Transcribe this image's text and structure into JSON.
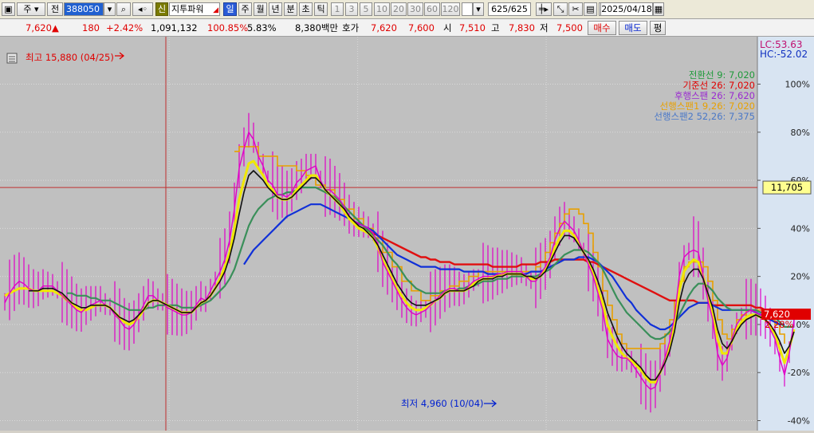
{
  "toolbar": {
    "period_label": "주",
    "market_label": "전",
    "stock_code": "388050",
    "new_badge": "신",
    "stock_name": "지투파워",
    "tab_day": "일",
    "tab_week": "주",
    "tab_month": "월",
    "tab_year": "년",
    "tab_minute": "분",
    "tab_second": "초",
    "tab_tick": "틱",
    "intervals": [
      "1",
      "3",
      "5",
      "10",
      "20",
      "30",
      "60",
      "120"
    ],
    "count": "625",
    "total": "/625",
    "date": "2025/04/18"
  },
  "quote": {
    "price": "7,620",
    "change": "180",
    "change_pct": "+2.42%",
    "volume": "1,091,132",
    "volume_ratio": "100.85%",
    "turnover": "5.83%",
    "amount": "8,380백만",
    "bid_ask_label": "호가",
    "ask": "7,620",
    "bid": "7,600",
    "open_label": "시",
    "open": "7,510",
    "high_label": "고",
    "high": "7,830",
    "low_label": "저",
    "low": "7,500",
    "buy_label": "매수",
    "sell_label": "매도",
    "avg_label": "평"
  },
  "colors": {
    "plot_bg": "#c0c0c0",
    "axis_bg": "#d8e4f2",
    "conversion": "#1e9a3a",
    "base": "#e00000",
    "lagging": "#9a2ad0",
    "span1": "#e8a000",
    "span2": "#4a78c8",
    "candle": "#e000c8",
    "ma_yellow": "#f0e800",
    "ma_black": "#111111",
    "ma_green": "#3a8f5a",
    "ma_blue": "#1030d8",
    "ma_red": "#e01010"
  },
  "chart_data": {
    "type": "line",
    "ylabel": "",
    "ylim": [
      -40,
      110
    ],
    "y_ticks": [
      "100%",
      "80%",
      "60%",
      "40%",
      "20%",
      "0%",
      "-20%",
      "-40%"
    ],
    "y_tick_values": [
      100,
      80,
      60,
      40,
      20,
      0,
      -20,
      -40
    ],
    "grid": true,
    "lc_label": "LC:53.63",
    "hc_label": "HC:-52.02",
    "crosshair_price": "11,705",
    "crosshair_y": 57,
    "last_price_label": "7,620",
    "last_pct_label": "2.28%",
    "last_y": 2.3,
    "high_annotation": "최고 15,880 (04/25)",
    "low_annotation": "최저 4,960 (10/04)",
    "legend": [
      {
        "name": "전환선 9: 7,020",
        "color": "#1e9a3a"
      },
      {
        "name": "기준선 26: 7,020",
        "color": "#e00000"
      },
      {
        "name": "후행스팬 26: 7,620",
        "color": "#9a2ad0"
      },
      {
        "name": "선행스팬1 9,26: 7,020",
        "color": "#e8a000"
      },
      {
        "name": "선행스팬2 52,26: 7,375",
        "color": "#4a78c8"
      }
    ],
    "x_count": 157,
    "series": [
      {
        "key": "close",
        "values": [
          9,
          13,
          16,
          18,
          17,
          15,
          14,
          14,
          16,
          16,
          16,
          14,
          12,
          10,
          8,
          6,
          5,
          7,
          8,
          9,
          10,
          8,
          7,
          4,
          2,
          -1,
          -2,
          0,
          4,
          8,
          12,
          12,
          10,
          9,
          7,
          6,
          5,
          4,
          4,
          5,
          8,
          11,
          10,
          14,
          18,
          22,
          27,
          35,
          48,
          65,
          73,
          80,
          77,
          70,
          66,
          60,
          58,
          54,
          54,
          53,
          55,
          59,
          61,
          64,
          65,
          66,
          60,
          56,
          56,
          54,
          52,
          49,
          45,
          43,
          42,
          41,
          40,
          38,
          33,
          26,
          22,
          18,
          14,
          10,
          7,
          5,
          4,
          5,
          6,
          8,
          10,
          12,
          14,
          15,
          15,
          14,
          14,
          16,
          18,
          19,
          20,
          20,
          20,
          21,
          21,
          22,
          22,
          22,
          22,
          20,
          18,
          18,
          21,
          24,
          28,
          35,
          40,
          43,
          41,
          39,
          35,
          30,
          25,
          20,
          13,
          6,
          -6,
          -10,
          -13,
          -14,
          -14,
          -16,
          -19,
          -22,
          -25,
          -27,
          -26,
          -20,
          -14,
          -7,
          3,
          20,
          28,
          30,
          31,
          30,
          20,
          10,
          2,
          -12,
          -17,
          -14,
          -6,
          0,
          3,
          5,
          6,
          5,
          4,
          2,
          -2,
          -6,
          -14,
          -21,
          -12,
          2
        ]
      },
      {
        "key": "yellow",
        "values": [
          12,
          13,
          14,
          15,
          15,
          15,
          14,
          14,
          14,
          14,
          14,
          13,
          12,
          10,
          9,
          7,
          6,
          6,
          7,
          8,
          8,
          8,
          7,
          5,
          3,
          1,
          0,
          1,
          3,
          6,
          9,
          10,
          10,
          9,
          8,
          7,
          6,
          5,
          5,
          5,
          7,
          9,
          10,
          12,
          15,
          19,
          24,
          30,
          40,
          52,
          60,
          67,
          68,
          65,
          62,
          58,
          56,
          53,
          52,
          52,
          53,
          56,
          58,
          60,
          62,
          62,
          59,
          56,
          54,
          52,
          50,
          47,
          44,
          42,
          40,
          39,
          38,
          36,
          32,
          27,
          23,
          19,
          15,
          12,
          9,
          7,
          6,
          6,
          7,
          8,
          10,
          11,
          13,
          14,
          14,
          14,
          14,
          15,
          17,
          18,
          19,
          19,
          20,
          20,
          21,
          21,
          21,
          21,
          21,
          20,
          19,
          19,
          20,
          23,
          27,
          32,
          36,
          39,
          39,
          37,
          34,
          30,
          26,
          21,
          15,
          9,
          0,
          -5,
          -9,
          -12,
          -14,
          -15,
          -17,
          -19,
          -22,
          -24,
          -24,
          -20,
          -15,
          -9,
          0,
          14,
          22,
          25,
          27,
          26,
          20,
          12,
          5,
          -6,
          -12,
          -12,
          -7,
          -2,
          1,
          3,
          4,
          4,
          3,
          2,
          -1,
          -4,
          -10,
          -16,
          -10,
          -2
        ]
      },
      {
        "key": "black",
        "values": [
          null,
          null,
          null,
          null,
          null,
          14,
          14,
          14,
          15,
          15,
          15,
          14,
          13,
          11,
          9,
          8,
          7,
          7,
          8,
          8,
          8,
          8,
          7,
          5,
          3,
          2,
          1,
          2,
          4,
          6,
          9,
          10,
          10,
          9,
          8,
          7,
          6,
          5,
          5,
          5,
          7,
          9,
          10,
          12,
          15,
          18,
          22,
          28,
          36,
          46,
          55,
          62,
          64,
          62,
          60,
          57,
          55,
          53,
          52,
          52,
          53,
          55,
          57,
          59,
          61,
          61,
          59,
          56,
          54,
          52,
          50,
          48,
          45,
          43,
          41,
          40,
          38,
          36,
          33,
          29,
          25,
          21,
          17,
          14,
          11,
          9,
          8,
          8,
          8,
          9,
          10,
          11,
          13,
          14,
          14,
          14,
          14,
          15,
          16,
          18,
          19,
          19,
          19,
          20,
          20,
          21,
          21,
          21,
          21,
          20,
          20,
          19,
          20,
          22,
          26,
          30,
          34,
          37,
          37,
          36,
          33,
          30,
          27,
          23,
          18,
          12,
          5,
          0,
          -5,
          -9,
          -12,
          -14,
          -16,
          -18,
          -21,
          -23,
          -23,
          -20,
          -16,
          -11,
          -3,
          9,
          17,
          21,
          23,
          23,
          19,
          13,
          7,
          -2,
          -8,
          -10,
          -7,
          -3,
          0,
          2,
          3,
          4,
          3,
          2,
          0,
          -3,
          -7,
          -12,
          -9,
          -3
        ]
      },
      {
        "key": "green",
        "values": [
          null,
          null,
          null,
          null,
          null,
          null,
          null,
          null,
          null,
          null,
          null,
          null,
          null,
          13,
          13,
          12,
          12,
          12,
          11,
          11,
          10,
          10,
          10,
          9,
          8,
          7,
          6,
          6,
          6,
          6,
          7,
          7,
          8,
          8,
          8,
          8,
          8,
          7,
          7,
          7,
          7,
          8,
          9,
          10,
          12,
          14,
          16,
          19,
          23,
          29,
          35,
          41,
          45,
          48,
          50,
          52,
          53,
          54,
          54,
          55,
          55,
          56,
          57,
          57,
          57,
          57,
          56,
          55,
          54,
          53,
          51,
          49,
          47,
          45,
          43,
          41,
          39,
          37,
          35,
          33,
          30,
          27,
          25,
          22,
          19,
          17,
          15,
          14,
          13,
          13,
          13,
          13,
          14,
          14,
          14,
          15,
          15,
          16,
          16,
          17,
          18,
          18,
          18,
          19,
          19,
          19,
          20,
          20,
          20,
          20,
          20,
          20,
          21,
          22,
          23,
          25,
          27,
          29,
          30,
          31,
          31,
          31,
          30,
          28,
          26,
          23,
          19,
          15,
          11,
          8,
          5,
          3,
          1,
          -1,
          -3,
          -5,
          -6,
          -6,
          -5,
          -3,
          0,
          4,
          8,
          12,
          15,
          17,
          17,
          16,
          14,
          11,
          9,
          7,
          6,
          6,
          6,
          6,
          6,
          6,
          5,
          5,
          4,
          3,
          1,
          -1,
          -1,
          -1
        ]
      },
      {
        "key": "blue",
        "values": [
          null,
          null,
          null,
          null,
          null,
          null,
          null,
          null,
          null,
          null,
          null,
          null,
          null,
          null,
          null,
          null,
          null,
          null,
          null,
          null,
          null,
          null,
          null,
          null,
          null,
          null,
          null,
          null,
          null,
          null,
          null,
          null,
          null,
          null,
          null,
          null,
          null,
          null,
          null,
          null,
          null,
          null,
          null,
          null,
          null,
          null,
          null,
          null,
          null,
          null,
          25,
          28,
          31,
          33,
          35,
          37,
          39,
          41,
          43,
          45,
          46,
          47,
          48,
          49,
          50,
          50,
          50,
          49,
          48,
          47,
          46,
          45,
          44,
          43,
          42,
          41,
          40,
          39,
          37,
          35,
          33,
          31,
          29,
          28,
          27,
          26,
          25,
          24,
          24,
          24,
          24,
          23,
          23,
          23,
          23,
          23,
          22,
          22,
          22,
          22,
          22,
          21,
          21,
          21,
          21,
          21,
          21,
          21,
          21,
          21,
          22,
          22,
          22,
          23,
          24,
          25,
          26,
          27,
          27,
          27,
          28,
          28,
          28,
          27,
          26,
          24,
          22,
          20,
          17,
          14,
          11,
          9,
          6,
          4,
          2,
          0,
          -1,
          -2,
          -2,
          -1,
          1,
          3,
          5,
          7,
          8,
          9,
          9,
          9,
          8,
          7,
          6,
          6,
          6,
          6,
          6,
          6,
          6,
          5,
          4,
          3,
          2,
          1,
          0,
          0
        ]
      },
      {
        "key": "red",
        "values": [
          null,
          null,
          null,
          null,
          null,
          null,
          null,
          null,
          null,
          null,
          null,
          null,
          null,
          null,
          null,
          null,
          null,
          null,
          null,
          null,
          null,
          null,
          null,
          null,
          null,
          null,
          null,
          null,
          null,
          null,
          null,
          null,
          null,
          null,
          null,
          null,
          null,
          null,
          null,
          null,
          null,
          null,
          null,
          null,
          null,
          null,
          null,
          null,
          null,
          null,
          null,
          null,
          null,
          null,
          null,
          null,
          null,
          null,
          null,
          null,
          null,
          null,
          null,
          null,
          null,
          null,
          null,
          null,
          null,
          null,
          null,
          null,
          null,
          null,
          null,
          null,
          39,
          38,
          37,
          36,
          35,
          34,
          33,
          32,
          31,
          30,
          29,
          28,
          28,
          27,
          27,
          26,
          26,
          26,
          25,
          25,
          25,
          25,
          25,
          25,
          25,
          25,
          24,
          24,
          24,
          24,
          24,
          24,
          25,
          25,
          25,
          25,
          26,
          26,
          26,
          27,
          27,
          27,
          27,
          27,
          27,
          27,
          26,
          26,
          25,
          24,
          23,
          22,
          21,
          20,
          19,
          18,
          17,
          16,
          15,
          14,
          13,
          12,
          11,
          10,
          10,
          10,
          10,
          10,
          10,
          9,
          9,
          9,
          8,
          8,
          8,
          8,
          8,
          8,
          8,
          8,
          8,
          7,
          7,
          6,
          5,
          5,
          4,
          4
        ]
      },
      {
        "key": "span",
        "values": [
          null,
          null,
          null,
          null,
          null,
          null,
          null,
          null,
          null,
          null,
          null,
          null,
          null,
          null,
          null,
          null,
          null,
          null,
          null,
          null,
          null,
          null,
          null,
          null,
          null,
          null,
          null,
          null,
          null,
          null,
          null,
          null,
          null,
          null,
          null,
          null,
          null,
          null,
          null,
          null,
          null,
          null,
          null,
          null,
          null,
          null,
          null,
          null,
          72,
          74,
          74,
          74,
          74,
          70,
          70,
          70,
          70,
          66,
          66,
          66,
          66,
          64,
          64,
          62,
          62,
          58,
          58,
          56,
          56,
          52,
          52,
          48,
          48,
          44,
          44,
          40,
          40,
          36,
          36,
          30,
          30,
          24,
          24,
          18,
          18,
          14,
          14,
          10,
          10,
          12,
          12,
          14,
          14,
          16,
          16,
          18,
          18,
          20,
          20,
          22,
          22,
          22,
          22,
          22,
          22,
          22,
          22,
          22,
          22,
          22,
          22,
          24,
          26,
          30,
          34,
          38,
          42,
          46,
          48,
          48,
          46,
          42,
          38,
          30,
          24,
          14,
          8,
          2,
          -4,
          -8,
          -10,
          -10,
          -10,
          -10,
          -10,
          -10,
          -10,
          -8,
          -4,
          2,
          10,
          18,
          24,
          26,
          26,
          26,
          24,
          18,
          10,
          2,
          -4,
          -6,
          -2,
          2,
          4,
          6,
          6,
          6,
          6,
          4,
          2,
          0,
          -4,
          -8
        ]
      }
    ]
  }
}
